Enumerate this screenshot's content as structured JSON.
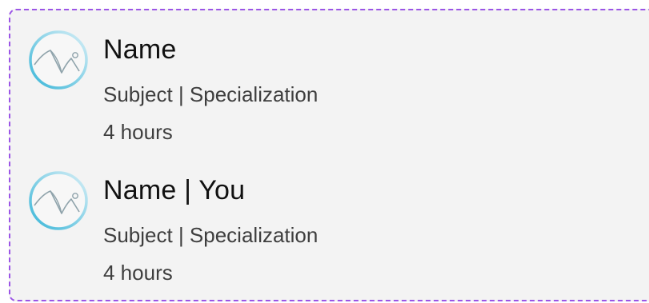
{
  "entries": [
    {
      "name": "Name",
      "subject": "Subject | Specialization",
      "duration": "4  hours",
      "avatar_icon": "image-placeholder-icon"
    },
    {
      "name": "Name | You",
      "subject": "Subject | Specialization",
      "duration": "4  hours",
      "avatar_icon": "image-placeholder-icon"
    }
  ],
  "colors": {
    "border_dash": "#9b55e6",
    "card_background": "#f3f3f3",
    "avatar_ring_start": "#3ab6d8",
    "avatar_ring_end": "#d6eef6"
  }
}
